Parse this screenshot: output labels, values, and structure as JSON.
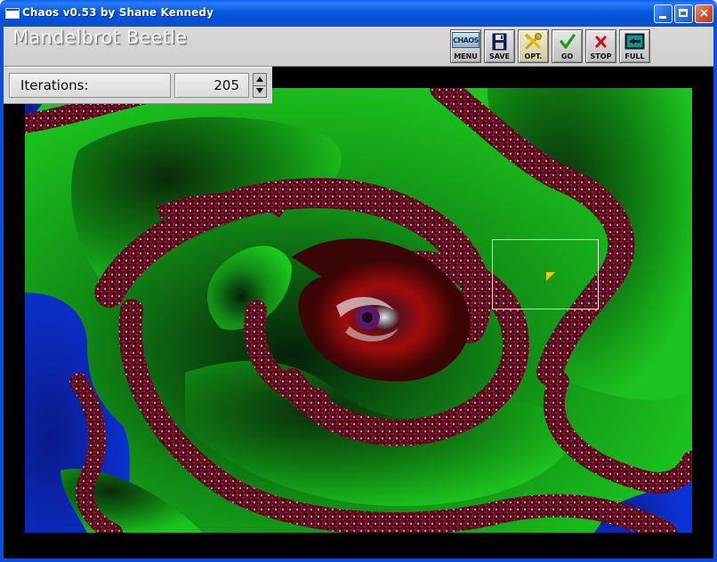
{
  "window": {
    "title": "Chaos v0.53 by Shane Kennedy",
    "controls": {
      "minimize": "minimize",
      "maximize": "maximize",
      "close": "×"
    }
  },
  "header": {
    "title": "Mandelbrot Beetle",
    "toolbar": [
      {
        "id": "menu",
        "label": "MENU",
        "icon": "chaos-logo-icon",
        "logo_text": "CHAOS"
      },
      {
        "id": "save",
        "label": "SAVE",
        "icon": "floppy-disk-icon"
      },
      {
        "id": "opt",
        "label": "OPT.",
        "icon": "tools-icon"
      },
      {
        "id": "go",
        "label": "GO",
        "icon": "checkmark-icon"
      },
      {
        "id": "stop",
        "label": "STOP",
        "icon": "x-icon"
      },
      {
        "id": "full",
        "label": "FULL",
        "icon": "fullscreen-icon"
      }
    ]
  },
  "iterations": {
    "label": "Iterations:",
    "value": "205"
  },
  "colors": {
    "titlebar": "#0a58e0",
    "fractal_green": "#19b81c",
    "fractal_red": "#8a0c0c",
    "fractal_blue": "#0a2acb",
    "selection": "#ffffff",
    "cursor": "#f2c410"
  }
}
